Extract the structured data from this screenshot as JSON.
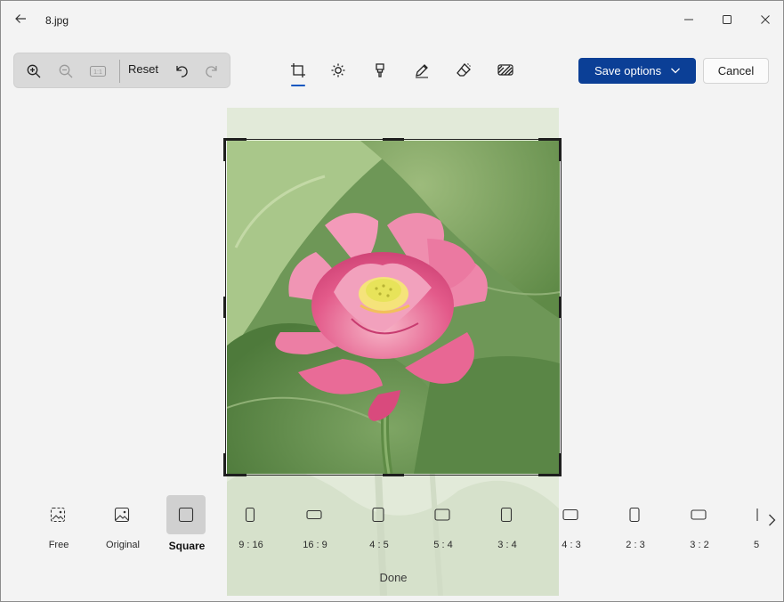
{
  "window": {
    "title": "8.jpg"
  },
  "toolbar": {
    "reset_label": "Reset",
    "save_label": "Save options",
    "cancel_label": "Cancel",
    "fit_label": "1:1",
    "accent": "#0b3f96"
  },
  "aspect_ratios": [
    {
      "label": "Free",
      "selected": false
    },
    {
      "label": "Original",
      "selected": false
    },
    {
      "label": "Square",
      "selected": true
    },
    {
      "label": "9 : 16",
      "selected": false
    },
    {
      "label": "16 : 9",
      "selected": false
    },
    {
      "label": "4 : 5",
      "selected": false
    },
    {
      "label": "5 : 4",
      "selected": false
    },
    {
      "label": "3 : 4",
      "selected": false
    },
    {
      "label": "4 : 3",
      "selected": false
    },
    {
      "label": "2 : 3",
      "selected": false
    },
    {
      "label": "3 : 2",
      "selected": false
    },
    {
      "label": "5",
      "selected": false
    }
  ],
  "done_label": "Done",
  "icons": {
    "back": "arrow-left-icon",
    "minimize": "minimize-icon",
    "maximize": "maximize-icon",
    "close": "close-icon",
    "zoom_in": "zoom-in-icon",
    "zoom_out": "zoom-out-icon",
    "undo": "undo-icon",
    "redo": "redo-icon",
    "crop": "crop-icon",
    "adjust": "brightness-icon",
    "filter": "filter-icon",
    "markup": "markup-pen-icon",
    "erase": "eraser-icon",
    "background": "background-blur-icon"
  }
}
